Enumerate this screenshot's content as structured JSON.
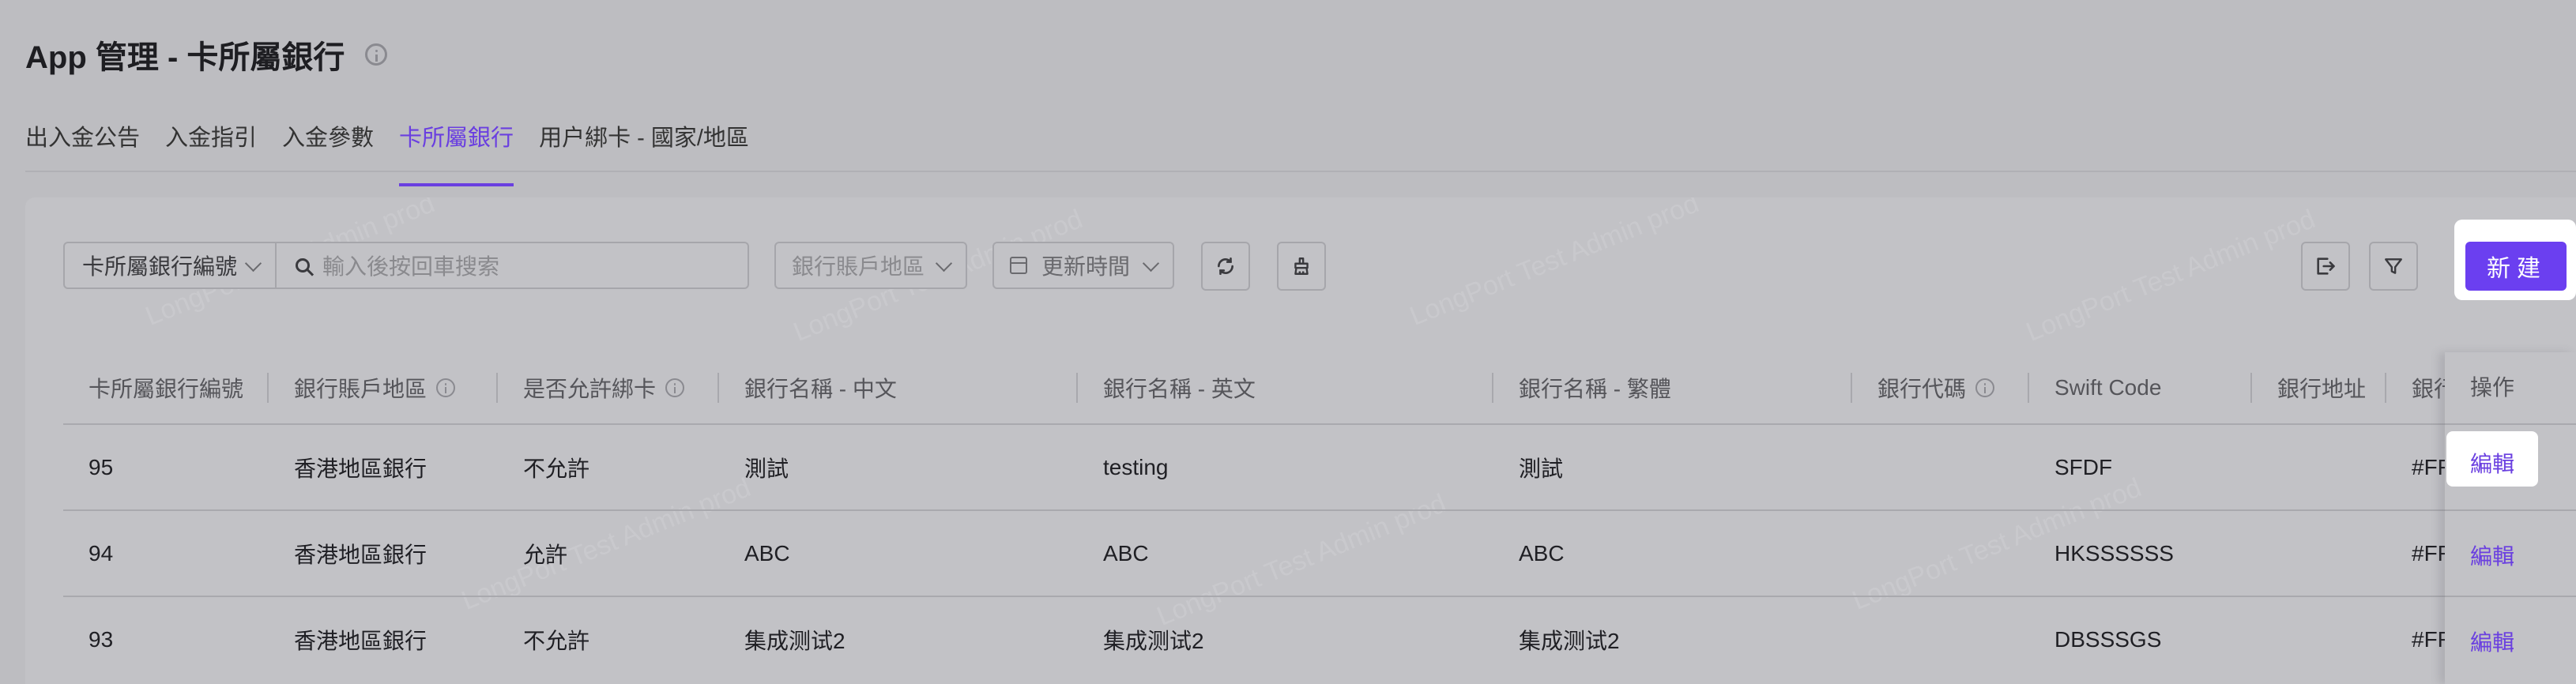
{
  "header": {
    "title": "App 管理 - 卡所屬銀行"
  },
  "tabs": [
    {
      "label": "出入金公告",
      "active": false
    },
    {
      "label": "入金指引",
      "active": false
    },
    {
      "label": "入金參數",
      "active": false
    },
    {
      "label": "卡所屬銀行",
      "active": true
    },
    {
      "label": "用户綁卡 - 國家/地區",
      "active": false
    }
  ],
  "toolbar": {
    "field_select": "卡所屬銀行編號",
    "search_placeholder": "輸入後按回車搜索",
    "region_placeholder": "銀行賬戶地區",
    "time_label": "更新時間",
    "create_label": "新建"
  },
  "table": {
    "columns": [
      {
        "label": "卡所屬銀行編號",
        "info": false
      },
      {
        "label": "銀行賬戶地區",
        "info": true
      },
      {
        "label": "是否允許綁卡",
        "info": true
      },
      {
        "label": "銀行名稱 - 中文",
        "info": false
      },
      {
        "label": "銀行名稱 - 英文",
        "info": false
      },
      {
        "label": "銀行名稱 - 繁體",
        "info": false
      },
      {
        "label": "銀行代碼",
        "info": true
      },
      {
        "label": "Swift Code",
        "info": false
      },
      {
        "label": "銀行地址",
        "info": false
      },
      {
        "label": "銀行",
        "info": false
      }
    ],
    "rows": [
      {
        "id": "95",
        "region": "香港地區銀行",
        "allow": "不允許",
        "name_cn": "測試",
        "name_en": "testing",
        "name_tc": "測試",
        "code": "",
        "swift": "SFDF",
        "address": "",
        "extra": "#FF"
      },
      {
        "id": "94",
        "region": "香港地區銀行",
        "allow": "允許",
        "name_cn": "ABC",
        "name_en": "ABC",
        "name_tc": "ABC",
        "code": "",
        "swift": "HKSSSSSS",
        "address": "",
        "extra": "#FF"
      },
      {
        "id": "93",
        "region": "香港地區銀行",
        "allow": "不允許",
        "name_cn": "集成测试2",
        "name_en": "集成测试2",
        "name_tc": "集成测试2",
        "code": "",
        "swift": "DBSSSGS",
        "address": "",
        "extra": "#FF"
      }
    ],
    "ops_header": "操作",
    "edit_label": "編輯"
  },
  "watermark": "LongPort Test Admin prod",
  "colors": {
    "accent": "#6b3ff0",
    "background": "#bdbdc1"
  }
}
